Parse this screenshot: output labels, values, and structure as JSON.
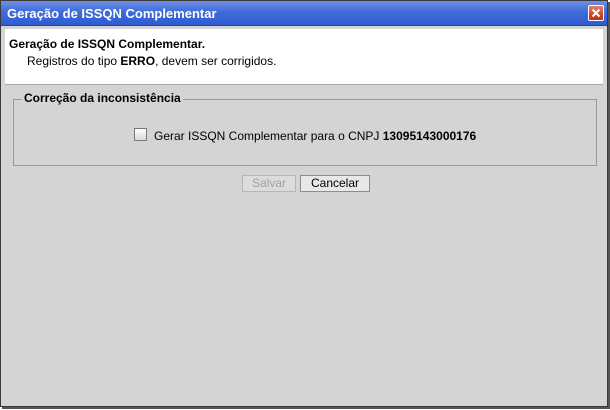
{
  "window": {
    "title": "Geração de ISSQN Complementar"
  },
  "header": {
    "title": "Geração de ISSQN Complementar.",
    "message_prefix": "Registros do tipo ",
    "message_bold": "ERRO",
    "message_suffix": ", devem ser corrigidos."
  },
  "correction_group": {
    "legend": "Correção da inconsistência",
    "checkbox_label": "Gerar ISSQN Complementar para o CNPJ ",
    "cnpj": "13095143000176",
    "checked": false
  },
  "buttons": {
    "save_label": "Salvar",
    "save_enabled": false,
    "cancel_label": "Cancelar"
  },
  "icons": {
    "close": "close-icon"
  },
  "colors": {
    "titlebar": "#3f6cd8",
    "dialog_background": "#d4d4d4",
    "close_button": "#d4432b"
  }
}
